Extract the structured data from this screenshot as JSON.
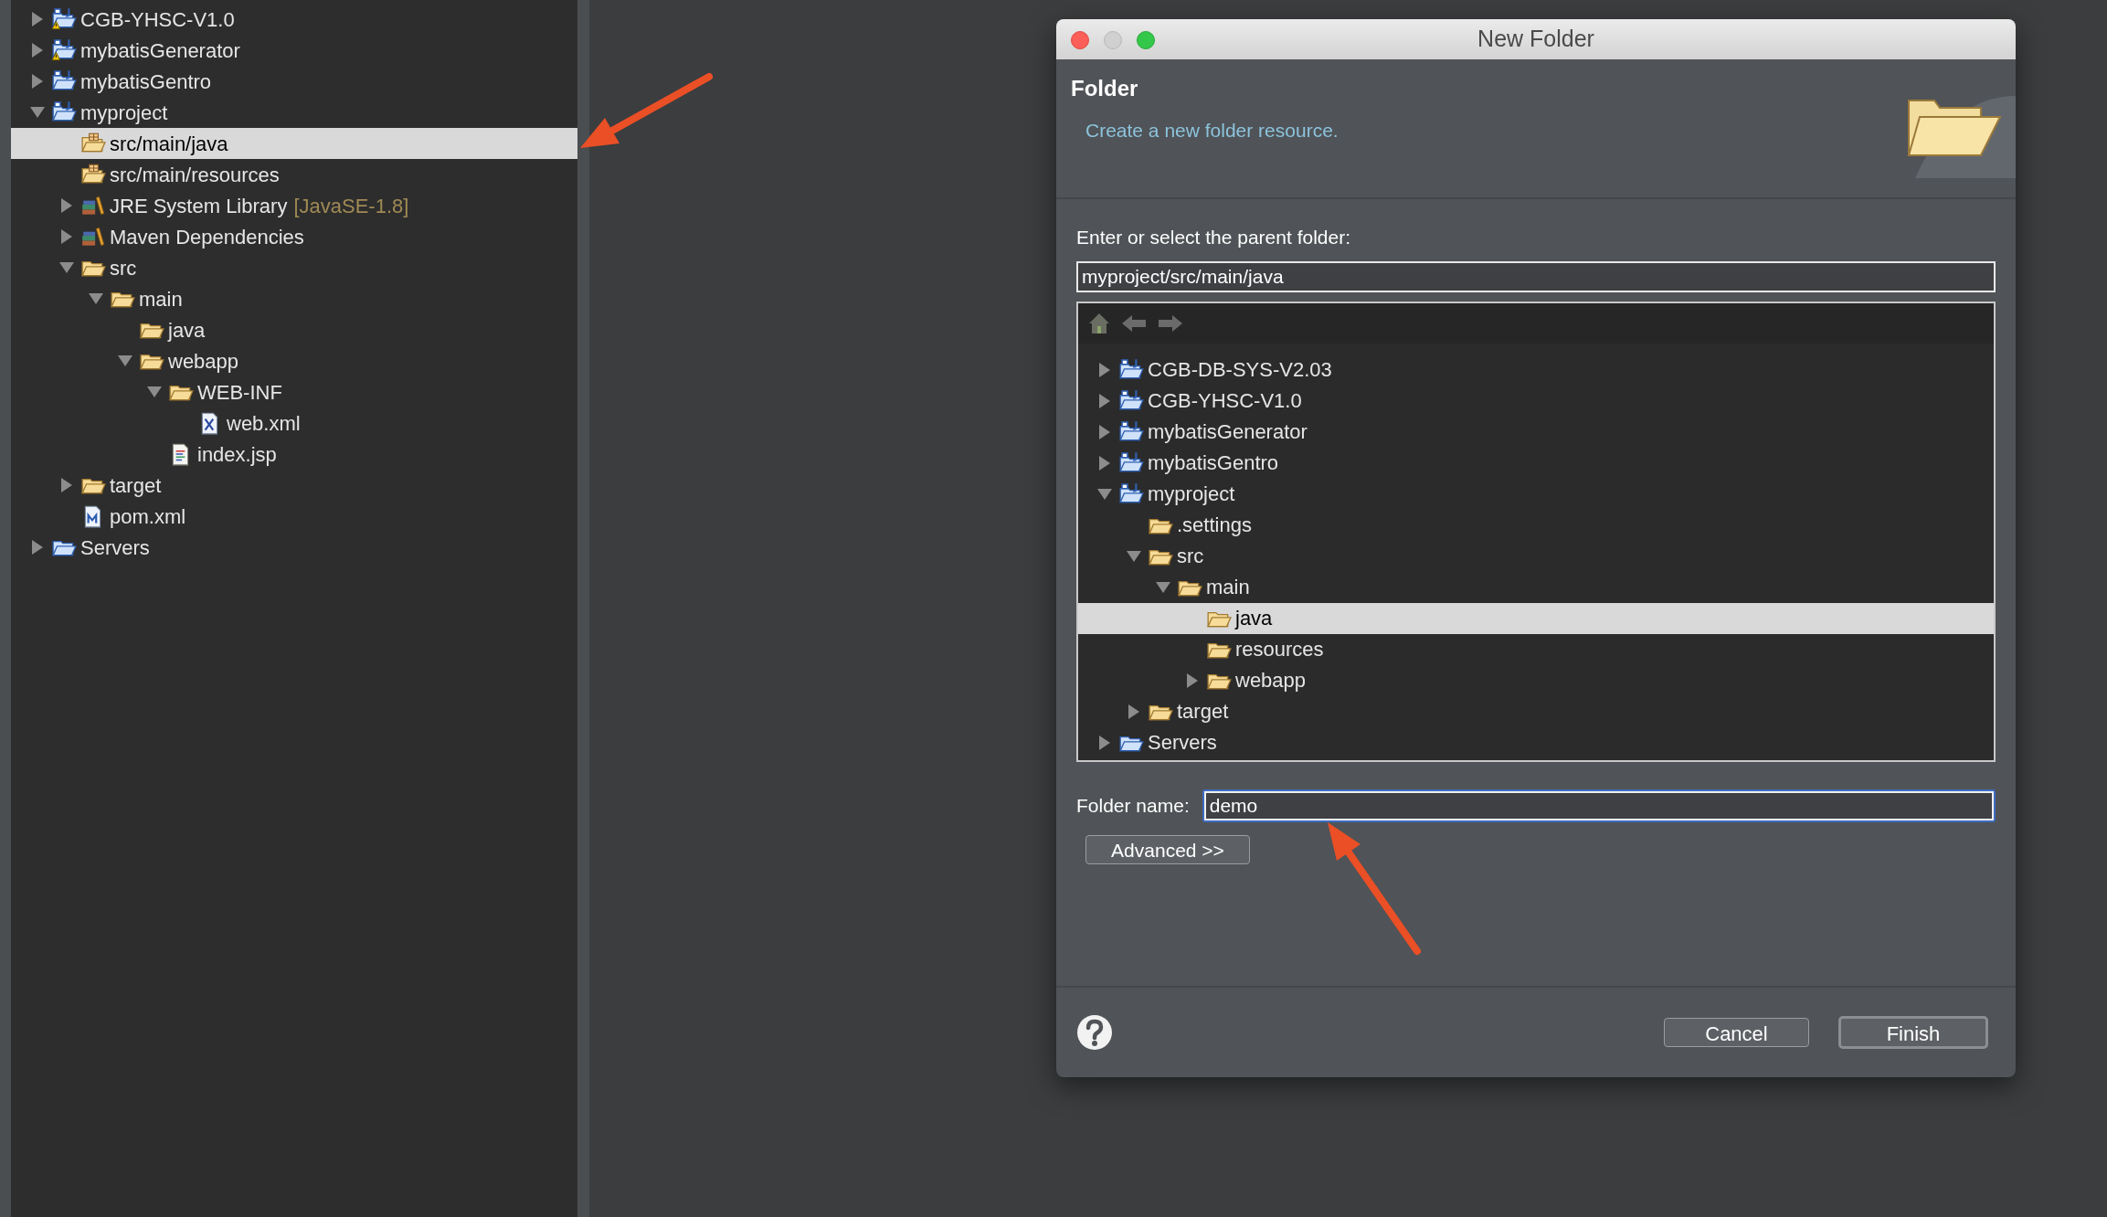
{
  "explorer": {
    "tree": [
      {
        "label": "CGB-YHSC-V1.0",
        "kind": "project",
        "warning": true,
        "expanded": false,
        "selected": false
      },
      {
        "label": "mybatisGenerator",
        "kind": "project",
        "warning": true,
        "expanded": false,
        "selected": false
      },
      {
        "label": "mybatisGentro",
        "kind": "project",
        "warning": false,
        "expanded": false,
        "selected": false
      },
      {
        "label": "myproject",
        "kind": "project",
        "warning": false,
        "expanded": true,
        "selected": false,
        "children": [
          {
            "label": "src/main/java",
            "kind": "source-folder",
            "selected": true
          },
          {
            "label": "src/main/resources",
            "kind": "source-folder",
            "selected": false
          },
          {
            "label": "JRE System Library",
            "qualifier": "[JavaSE-1.8]",
            "kind": "library",
            "expanded": false,
            "selected": false
          },
          {
            "label": "Maven Dependencies",
            "kind": "library",
            "expanded": false,
            "selected": false
          },
          {
            "label": "src",
            "kind": "folder",
            "expanded": true,
            "selected": false,
            "children": [
              {
                "label": "main",
                "kind": "folder",
                "expanded": true,
                "selected": false,
                "children": [
                  {
                    "label": "java",
                    "kind": "folder",
                    "selected": false
                  },
                  {
                    "label": "webapp",
                    "kind": "folder",
                    "expanded": true,
                    "selected": false,
                    "children": [
                      {
                        "label": "WEB-INF",
                        "kind": "folder",
                        "expanded": true,
                        "selected": false,
                        "children": [
                          {
                            "label": "web.xml",
                            "kind": "xml-file",
                            "selected": false
                          }
                        ]
                      },
                      {
                        "label": "index.jsp",
                        "kind": "jsp-file",
                        "selected": false
                      }
                    ]
                  }
                ]
              }
            ]
          },
          {
            "label": "target",
            "kind": "folder",
            "expanded": false,
            "selected": false
          },
          {
            "label": "pom.xml",
            "kind": "pom-file",
            "selected": false
          }
        ]
      },
      {
        "label": "Servers",
        "kind": "servers",
        "expanded": false,
        "selected": false
      }
    ]
  },
  "dialog": {
    "title": "New Folder",
    "header_title": "Folder",
    "header_message": "Create a new folder resource.",
    "parent_label": "Enter or select the parent folder:",
    "parent_value": "myproject/src/main/java",
    "tree": [
      {
        "label": "CGB-DB-SYS-V2.03",
        "kind": "project",
        "warning": false,
        "expanded": false,
        "selected": false
      },
      {
        "label": "CGB-YHSC-V1.0",
        "kind": "project",
        "warning": false,
        "expanded": false,
        "selected": false
      },
      {
        "label": "mybatisGenerator",
        "kind": "project",
        "warning": false,
        "expanded": false,
        "selected": false
      },
      {
        "label": "mybatisGentro",
        "kind": "project",
        "warning": false,
        "expanded": false,
        "selected": false
      },
      {
        "label": "myproject",
        "kind": "project",
        "warning": false,
        "expanded": true,
        "selected": false,
        "children": [
          {
            "label": ".settings",
            "kind": "folder",
            "selected": false
          },
          {
            "label": "src",
            "kind": "folder",
            "expanded": true,
            "selected": false,
            "children": [
              {
                "label": "main",
                "kind": "folder",
                "expanded": true,
                "selected": false,
                "children": [
                  {
                    "label": "java",
                    "kind": "folder",
                    "selected": true
                  },
                  {
                    "label": "resources",
                    "kind": "folder",
                    "selected": false
                  },
                  {
                    "label": "webapp",
                    "kind": "folder",
                    "expanded": false,
                    "selected": false
                  }
                ]
              }
            ]
          },
          {
            "label": "target",
            "kind": "folder",
            "expanded": false,
            "selected": false
          }
        ]
      },
      {
        "label": "Servers",
        "kind": "servers",
        "expanded": false,
        "selected": false
      }
    ],
    "folder_name_label": "Folder name:",
    "folder_name_value": "demo",
    "advanced_button": "Advanced >>",
    "buttons": [
      {
        "label": "Cancel",
        "default": false
      },
      {
        "label": "Finish",
        "default": true
      }
    ]
  }
}
